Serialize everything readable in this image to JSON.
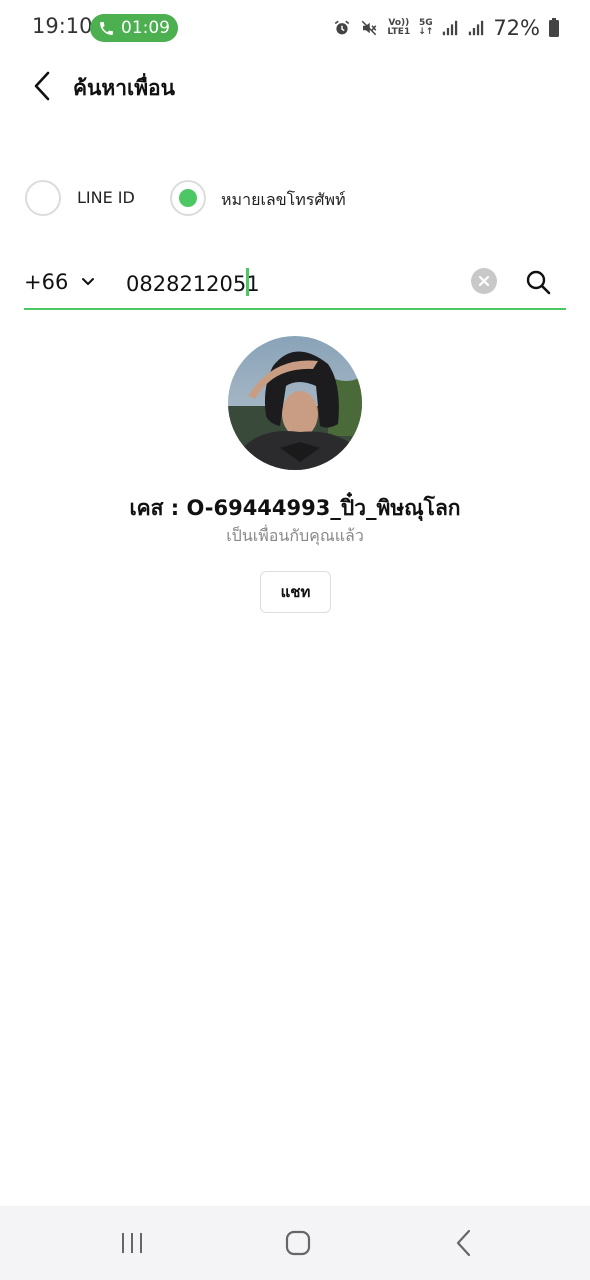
{
  "status_bar": {
    "time": "19:10",
    "call_timer": "01:09",
    "battery_percent": "72%",
    "network_5g": "5G",
    "volte_top": "Vo))",
    "volte_bottom": "LTE1",
    "icons": [
      "phone-icon",
      "alarm-icon",
      "mute-icon",
      "volte-icon",
      "5g-icon",
      "signal-icon",
      "signal-icon",
      "battery-icon"
    ],
    "accent_color": "#4caf50"
  },
  "header": {
    "title": "ค้นหาเพื่อน"
  },
  "search_type": {
    "options": [
      {
        "label": "LINE ID",
        "selected": false
      },
      {
        "label": "หมายเลขโทรศัพท์",
        "selected": true
      }
    ],
    "selected_color": "#4cc764"
  },
  "search": {
    "country_code": "+66",
    "phone_value": "0828212051"
  },
  "result": {
    "name": "เคส : O-69444993_ปิ๋ว_พิษณุโลก",
    "status": "เป็นเพื่อนกับคุณแล้ว",
    "chat_label": "แชท"
  },
  "nav_bar": {
    "icons": [
      "recent-apps-icon",
      "home-icon",
      "back-icon"
    ]
  }
}
